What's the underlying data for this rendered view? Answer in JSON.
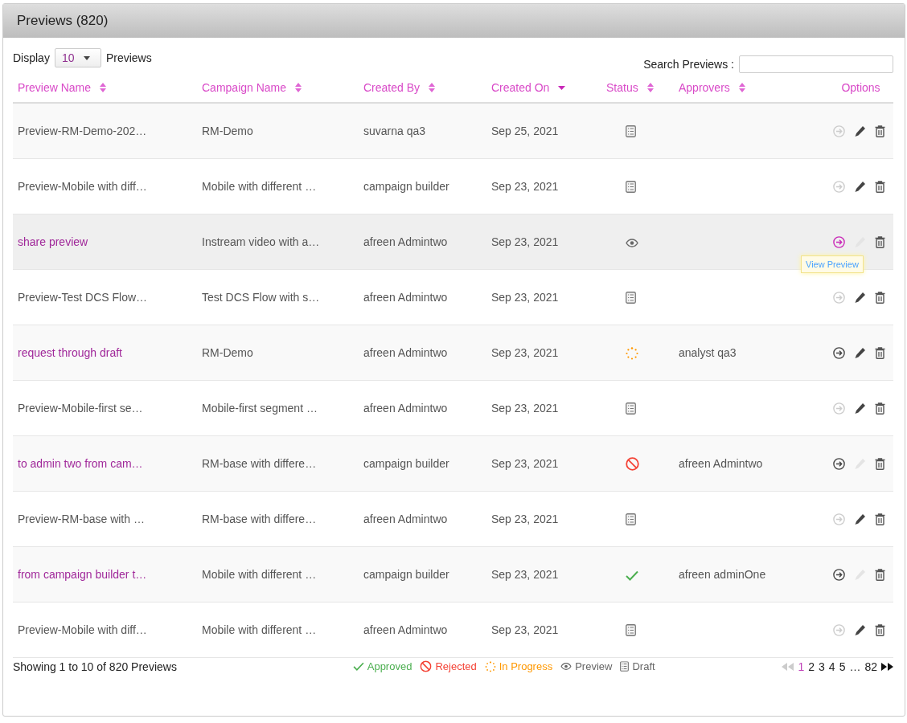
{
  "panel": {
    "title": "Previews (820)"
  },
  "display": {
    "label": "Display",
    "value": "10",
    "suffix": "Previews"
  },
  "search": {
    "label": "Search Previews :"
  },
  "columns": [
    {
      "label": "Preview Name",
      "kind": "sortable"
    },
    {
      "label": "Campaign Name",
      "kind": "sortable"
    },
    {
      "label": "Created By",
      "kind": "sortable"
    },
    {
      "label": "Created On",
      "kind": "sorted"
    },
    {
      "label": "Status",
      "kind": "sortable"
    },
    {
      "label": "Approvers",
      "kind": "sortable"
    },
    {
      "label": "Options",
      "kind": "plain"
    }
  ],
  "rows": [
    {
      "name": "Preview-RM-Demo-202…",
      "link": false,
      "campaign": "RM-Demo",
      "created_by": "suvarna qa3",
      "created_on": "Sep 25, 2021",
      "kind": "draft",
      "approvers": "",
      "view_enabled": false,
      "edit_enabled": true,
      "hovered": false
    },
    {
      "name": "Preview-Mobile with diff…",
      "link": false,
      "campaign": "Mobile with different …",
      "created_by": "campaign builder",
      "created_on": "Sep 23, 2021",
      "kind": "draft",
      "approvers": "",
      "view_enabled": false,
      "edit_enabled": true,
      "hovered": false
    },
    {
      "name": "share preview",
      "link": true,
      "campaign": "Instream video with a…",
      "created_by": "afreen Admintwo",
      "created_on": "Sep 23, 2021",
      "kind": "preview",
      "approvers": "",
      "view_enabled": true,
      "edit_enabled": false,
      "hovered": true,
      "tooltip": "View Preview"
    },
    {
      "name": "Preview-Test DCS Flow…",
      "link": false,
      "campaign": "Test DCS Flow with s…",
      "created_by": "afreen Admintwo",
      "created_on": "Sep 23, 2021",
      "kind": "draft",
      "approvers": "",
      "view_enabled": false,
      "edit_enabled": true,
      "hovered": false
    },
    {
      "name": "request through draft",
      "link": true,
      "campaign": "RM-Demo",
      "created_by": "afreen Admintwo",
      "created_on": "Sep 23, 2021",
      "kind": "in_progress",
      "approvers": "analyst qa3",
      "view_enabled": true,
      "edit_enabled": true,
      "hovered": false
    },
    {
      "name": "Preview-Mobile-first se…",
      "link": false,
      "campaign": "Mobile-first segment …",
      "created_by": "afreen Admintwo",
      "created_on": "Sep 23, 2021",
      "kind": "draft",
      "approvers": "",
      "view_enabled": false,
      "edit_enabled": true,
      "hovered": false
    },
    {
      "name": "to admin two from cam…",
      "link": true,
      "campaign": "RM-base with differe…",
      "created_by": "campaign builder",
      "created_on": "Sep 23, 2021",
      "kind": "rejected",
      "approvers": "afreen Admintwo",
      "view_enabled": true,
      "edit_enabled": false,
      "hovered": false
    },
    {
      "name": "Preview-RM-base with …",
      "link": false,
      "campaign": "RM-base with differe…",
      "created_by": "afreen Admintwo",
      "created_on": "Sep 23, 2021",
      "kind": "draft",
      "approvers": "",
      "view_enabled": false,
      "edit_enabled": true,
      "hovered": false
    },
    {
      "name": "from campaign builder t…",
      "link": true,
      "campaign": "Mobile with different …",
      "created_by": "campaign builder",
      "created_on": "Sep 23, 2021",
      "kind": "approved",
      "approvers": "afreen adminOne",
      "view_enabled": true,
      "edit_enabled": false,
      "hovered": false
    },
    {
      "name": "Preview-Mobile with diff…",
      "link": false,
      "campaign": "Mobile with different …",
      "created_by": "afreen Admintwo",
      "created_on": "Sep 23, 2021",
      "kind": "draft",
      "approvers": "",
      "view_enabled": false,
      "edit_enabled": true,
      "hovered": false
    }
  ],
  "footer": {
    "showing": "Showing 1 to 10 of 820 Previews"
  },
  "legend": [
    {
      "kind": "approved",
      "label": "Approved"
    },
    {
      "kind": "rejected",
      "label": "Rejected"
    },
    {
      "kind": "in_progress",
      "label": "In Progress"
    },
    {
      "kind": "preview",
      "label": "Preview"
    },
    {
      "kind": "draft",
      "label": "Draft"
    }
  ],
  "pagination": {
    "prev_enabled": false,
    "next_enabled": true,
    "pages": [
      {
        "label": "1",
        "selected": true
      },
      {
        "label": "2",
        "selected": false
      },
      {
        "label": "3",
        "selected": false
      },
      {
        "label": "4",
        "selected": false
      },
      {
        "label": "5",
        "selected": false
      }
    ],
    "ellipsis": "…",
    "last": "82"
  }
}
